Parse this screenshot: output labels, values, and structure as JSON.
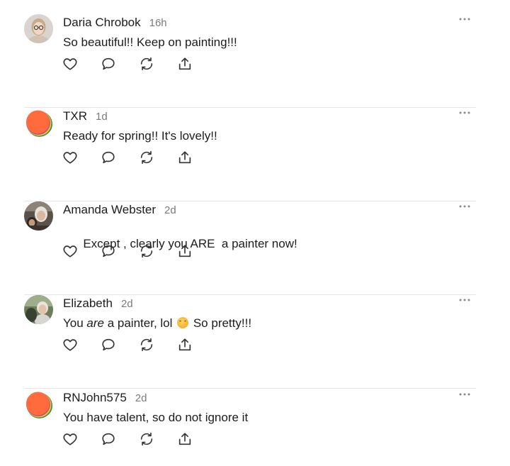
{
  "comments": [
    {
      "author": "Daria Chrobok",
      "time": "16h",
      "text_parts": [
        "So beautiful!! Keep on painting!!!"
      ],
      "avatar": "photo-woman-glasses"
    },
    {
      "author": "TXR",
      "time": "1d",
      "text_parts": [
        "Ready for spring!! It's lovely!!"
      ],
      "avatar": "default-orange-green"
    },
    {
      "author": "Amanda Webster",
      "time": "2d",
      "text_parts": [
        "Except , clearly you ARE  a painter now!"
      ],
      "avatar": "photo-people"
    },
    {
      "author": "Elizabeth",
      "time": "2d",
      "text_before": "You ",
      "text_em": "are",
      "text_after": " a painter, lol ",
      "text_tail": " So pretty!!!",
      "emoji": "hugging-face",
      "avatar": "photo-outdoor"
    },
    {
      "author": "RNJohn575",
      "time": "2d",
      "text_parts": [
        "You have talent, so do not ignore it"
      ],
      "avatar": "default-orange-green"
    }
  ],
  "icons": {
    "like": "heart-icon",
    "reply": "comment-bubble-icon",
    "restack": "restack-icon",
    "share": "share-icon",
    "more": "more-dots-icon"
  },
  "colors": {
    "text": "#1c1c1c",
    "meta": "#7a7a7a",
    "divider": "#e6e6e6",
    "icon": "#333333",
    "default_avatar_orange": "#ff6b3d",
    "default_avatar_green": "#2f8f3a"
  }
}
